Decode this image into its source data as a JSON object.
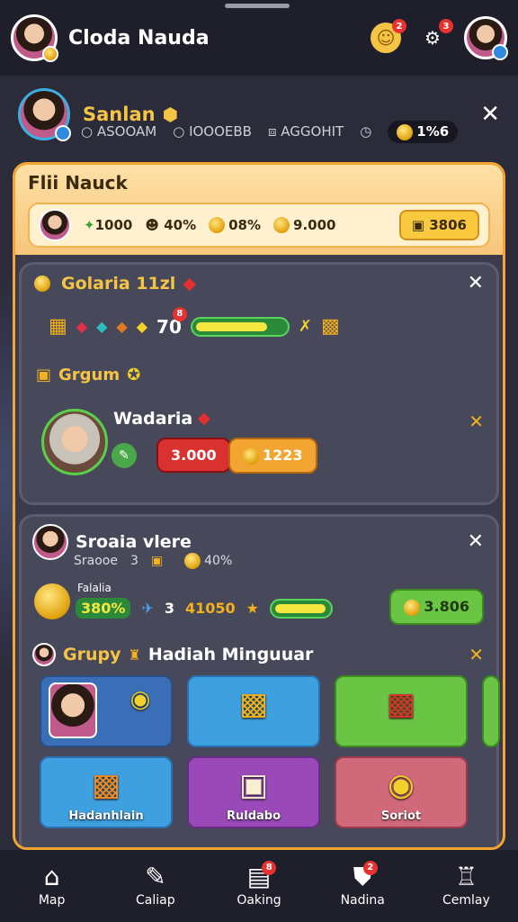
{
  "header": {
    "title": "Cloda Nauda",
    "notif_badge": "2",
    "settings_badge": "3"
  },
  "profile": {
    "name": "Sanlan",
    "stat1": "ASOOAM",
    "stat2": "IOOOEBB",
    "stat3": "AGGOHIT",
    "coin_pill": "1%6"
  },
  "main_card": {
    "title": "Flii Nauck",
    "val1": "1000",
    "val2": "40%",
    "val3": "08%",
    "val4": "9.000",
    "btn": "3806"
  },
  "section1": {
    "title": "Golaria 11zl",
    "progress_label": "70",
    "progress_badge": "8",
    "progress_pct": 0.75,
    "group_label": "Grgum",
    "member_name": "Wadaria",
    "btn_red": "3.000",
    "btn_orange": "1223"
  },
  "section2": {
    "title": "Sroaia vlere",
    "meta1": "Sraooe",
    "meta2": "3",
    "meta3": "40%",
    "sub_label": "Falalia",
    "pct": "380%",
    "val": "3",
    "val2": "41050",
    "progress_pct": 0.85,
    "btn_green": "3.806",
    "reward_title": "Grupy",
    "reward_title2": "Hadiah Minguuar",
    "tiles": [
      {
        "label": ""
      },
      {
        "label": ""
      },
      {
        "label": ""
      },
      {
        "label": "Hadanhlain"
      },
      {
        "label": "Ruldabo"
      },
      {
        "label": "Soriot"
      }
    ]
  },
  "nav": [
    {
      "label": "Map",
      "icon": "home-icon"
    },
    {
      "label": "Caliap",
      "icon": "tool-icon"
    },
    {
      "label": "Oaking",
      "icon": "chest-icon",
      "badge": "8"
    },
    {
      "label": "Nadina",
      "icon": "shield-icon",
      "badge": "2"
    },
    {
      "label": "Cemlay",
      "icon": "trophy-icon"
    }
  ],
  "colors": {
    "accent": "#f6c445",
    "border": "#f2a531",
    "bg": "#2b2b3a",
    "bar": "#1f1f2b"
  }
}
